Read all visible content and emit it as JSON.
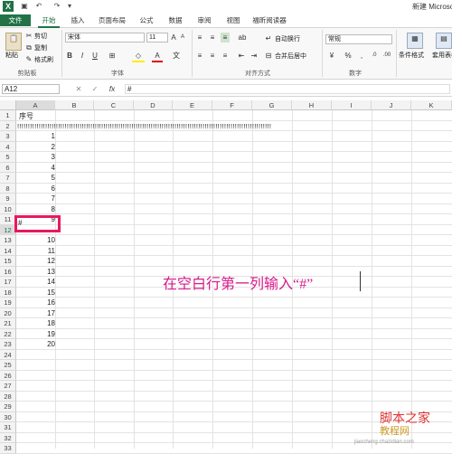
{
  "app": {
    "icon": "X",
    "title": "新建 Microso"
  },
  "quick_access": [
    "save-icon",
    "undo-icon",
    "redo-icon",
    "customize-icon"
  ],
  "tabs": [
    "文件",
    "开始",
    "插入",
    "页面布局",
    "公式",
    "数据",
    "审阅",
    "视图",
    "福昕阅读器"
  ],
  "ribbon": {
    "paste": "粘贴",
    "cut": "剪切",
    "copy": "复制",
    "format_painter": "格式刷",
    "clipboard_group": "剪贴板",
    "font_name": "宋体",
    "font_size": "11",
    "font_group": "字体",
    "bold": "B",
    "italic": "I",
    "underline": "U",
    "align_group": "对齐方式",
    "wrap_text": "自动换行",
    "merge_center": "合并后居中",
    "number_format": "常规",
    "number_group": "数字",
    "percent": "%",
    "comma": ",",
    "conditional_format": "条件格式",
    "table_format": "套用表格格"
  },
  "formula_bar": {
    "name_box": "A12",
    "fx": "fx",
    "cancel": "✕",
    "enter": "✓",
    "value": "#"
  },
  "columns": [
    "A",
    "B",
    "C",
    "D",
    "E",
    "F",
    "G",
    "H",
    "I",
    "J",
    "K"
  ],
  "rows": [
    "1",
    "2",
    "3",
    "4",
    "5",
    "6",
    "7",
    "8",
    "9",
    "10",
    "11",
    "12",
    "13",
    "14",
    "15",
    "16",
    "17",
    "18",
    "19",
    "20",
    "21",
    "22",
    "23",
    "24",
    "25",
    "26",
    "27",
    "28",
    "29",
    "30",
    "31",
    "32",
    "33"
  ],
  "cells": {
    "a1": "序号",
    "row2_fill": "!!!!!!!!!!!!!!!!!!!!!!!!!!!!!!!!!!!!!!!!!!!!!!!!!!!!!!!!!!!!!!!!!!!!!!!!!!!!!!!!!!!!!!!!!!!!!!!!!!!!!!!!!!!!!!!!!!!!!!",
    "a12": "#",
    "numbers_top": [
      "1",
      "2",
      "3",
      "4",
      "5",
      "6",
      "7",
      "8",
      "9"
    ],
    "numbers_bottom": [
      "10",
      "11",
      "12",
      "13",
      "14",
      "15",
      "16",
      "17",
      "18",
      "19",
      "20"
    ]
  },
  "annotation": "在空白行第一列输入“#”",
  "watermark": {
    "line1": "脚本之家",
    "line2": "教程网",
    "line3": "jiaocheng.chazidian.com"
  },
  "colors": {
    "accent": "#217346",
    "highlight": "#e8195e",
    "annotation": "#d8198a"
  }
}
